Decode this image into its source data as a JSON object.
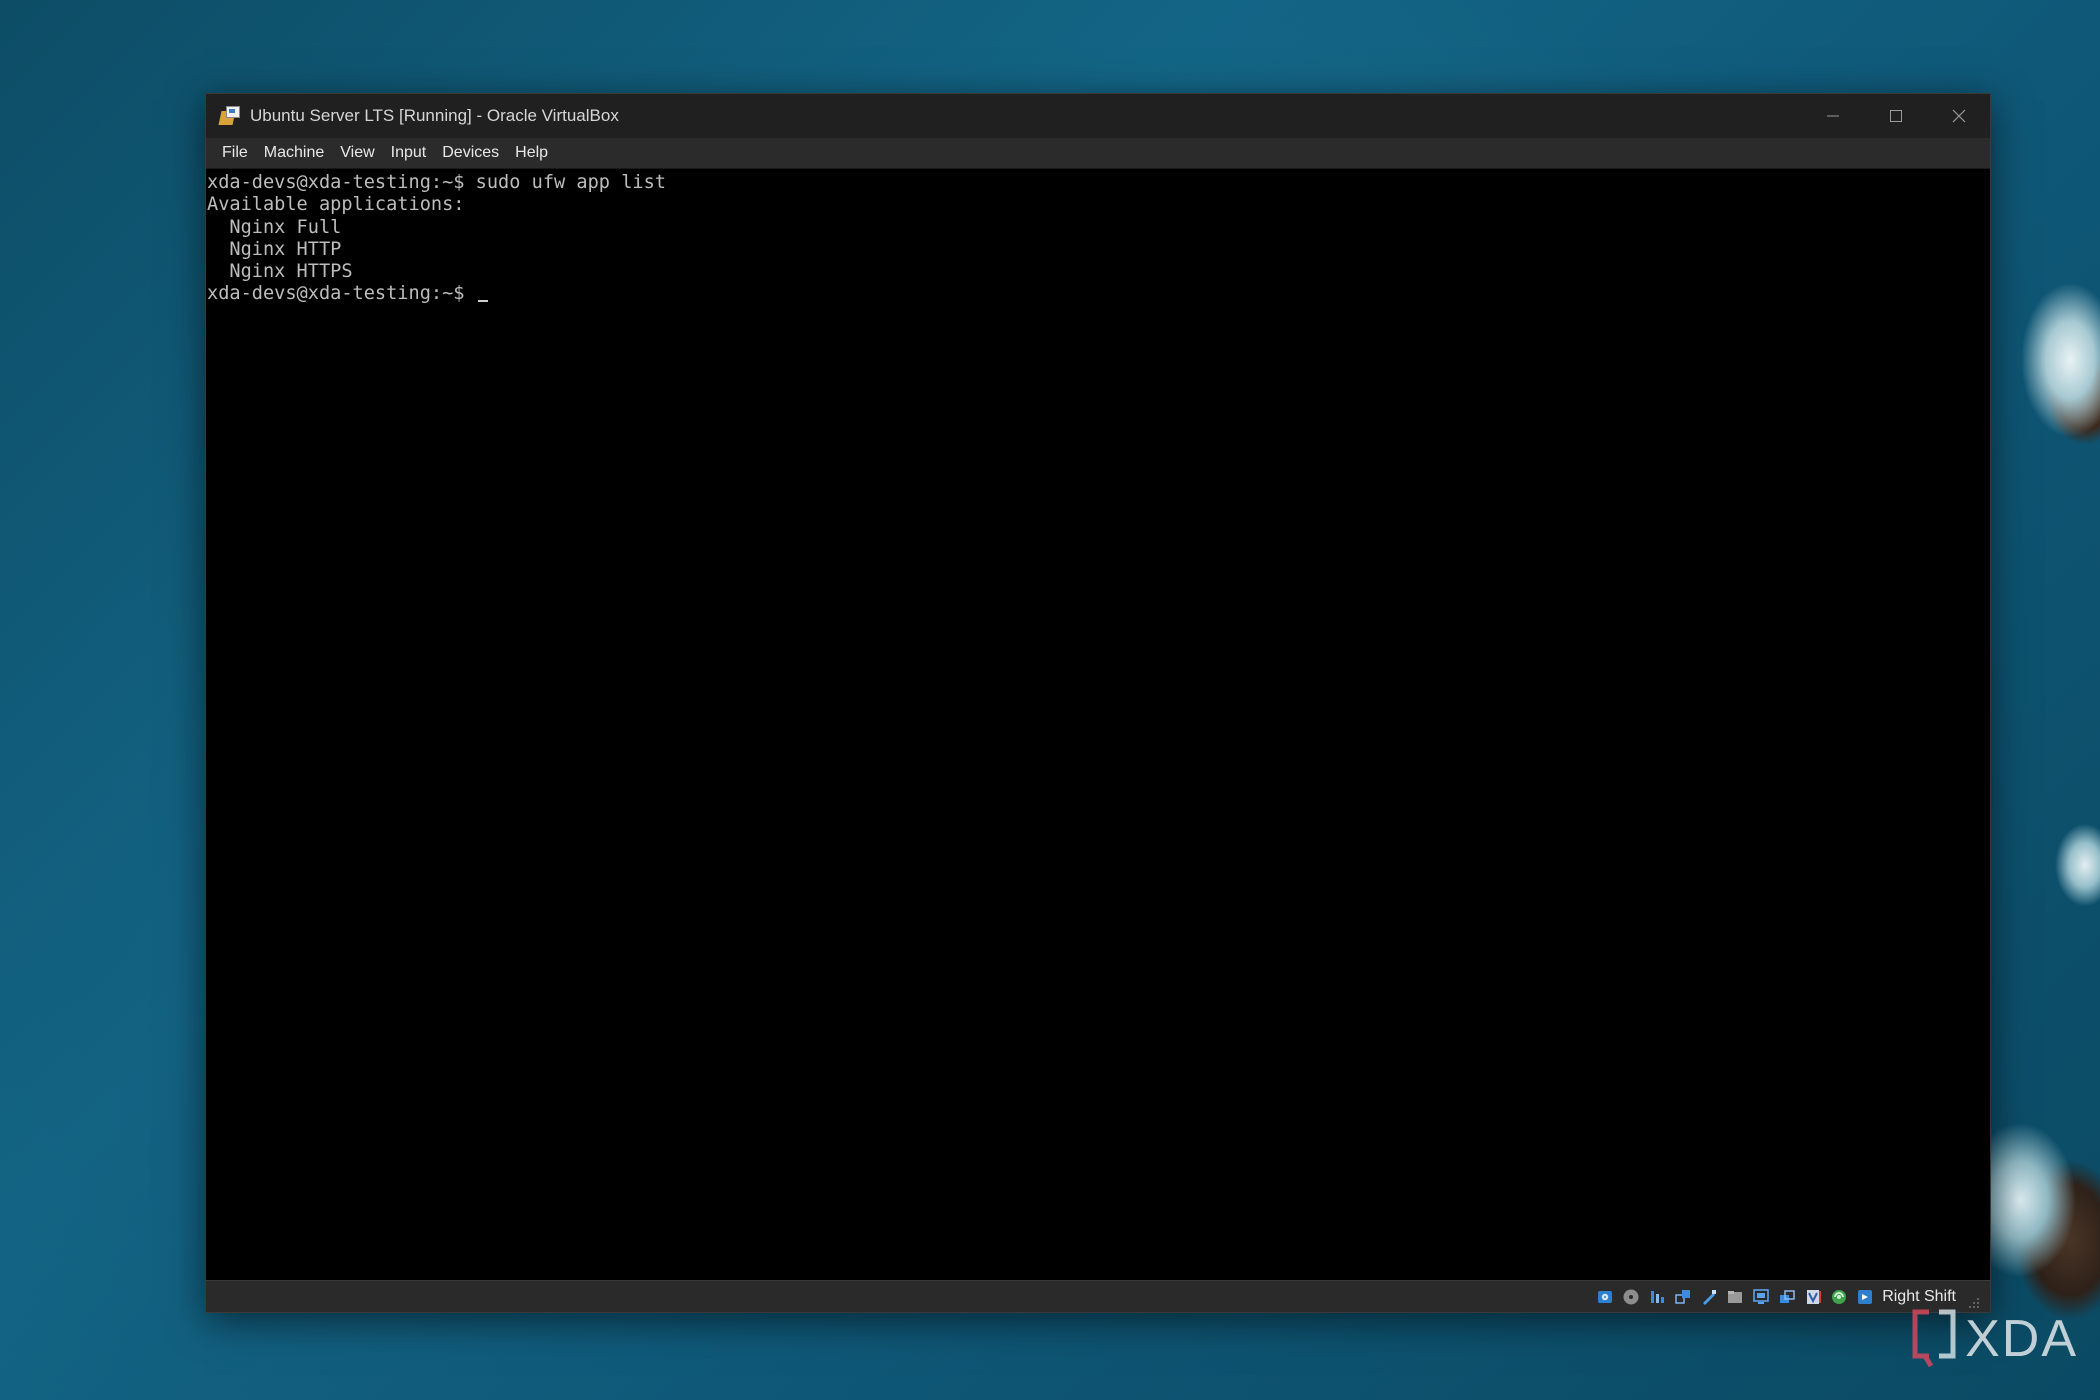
{
  "window": {
    "title": "Ubuntu Server LTS [Running] - Oracle VirtualBox",
    "icon": "virtualbox-icon",
    "controls": [
      "minimize-icon",
      "maximize-icon",
      "close-icon"
    ]
  },
  "menu": [
    {
      "label": "File"
    },
    {
      "label": "Machine"
    },
    {
      "label": "View"
    },
    {
      "label": "Input"
    },
    {
      "label": "Devices"
    },
    {
      "label": "Help"
    }
  ],
  "terminal": {
    "lines": [
      "xda-devs@xda-testing:~$ sudo ufw app list",
      "Available applications:",
      "  Nginx Full",
      "  Nginx HTTP",
      "  Nginx HTTPS"
    ],
    "prompt": "xda-devs@xda-testing:~$ "
  },
  "statusbar": {
    "icons": [
      "hard-disk-icon",
      "optical-drive-icon",
      "audio-icon",
      "network-icon",
      "usb-icon",
      "shared-folders-icon",
      "display-icon",
      "recording-icon",
      "virtualization-icon",
      "mouse-integration-icon",
      "keyboard-capture-icon"
    ],
    "host_key": "Right Shift"
  },
  "watermark": {
    "text": "XDA"
  },
  "colors": {
    "titlebar": "#202020",
    "menubar": "#2b2b2b",
    "terminal_bg": "#000000",
    "terminal_fg": "#bdbdbd",
    "desktop": "#136586"
  }
}
